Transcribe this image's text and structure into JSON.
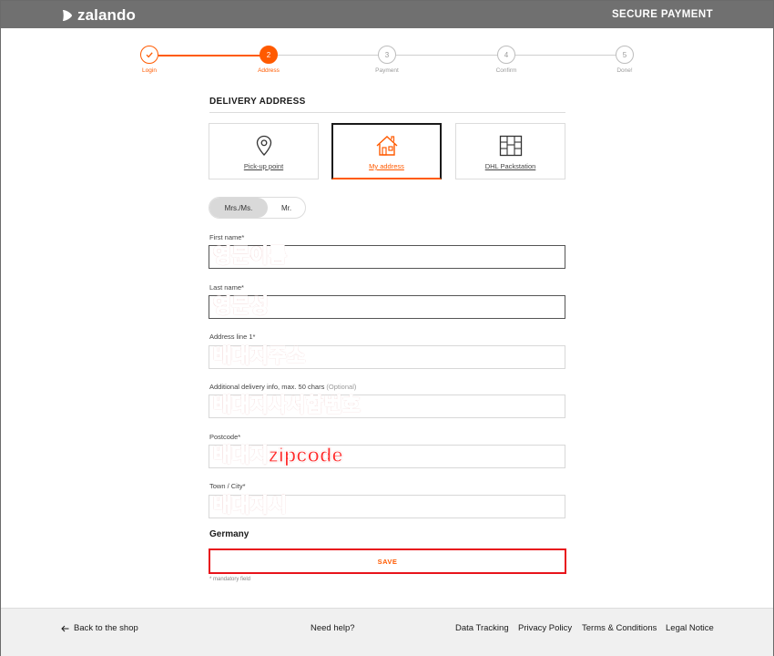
{
  "header": {
    "brand": "zalando",
    "secure_label": "SECURE PAYMENT",
    "bg_color": "#707070",
    "accent_color": "#ff5a00"
  },
  "steps": [
    {
      "number": "1",
      "label": "Login",
      "state": "done"
    },
    {
      "number": "2",
      "label": "Address",
      "state": "active"
    },
    {
      "number": "3",
      "label": "Payment",
      "state": "todo"
    },
    {
      "number": "4",
      "label": "Confirm",
      "state": "todo"
    },
    {
      "number": "5",
      "label": "Done!",
      "state": "todo"
    }
  ],
  "delivery": {
    "title": "DELIVERY ADDRESS",
    "options": [
      {
        "label": "Pick-up point",
        "icon": "location-pin-icon",
        "selected": false
      },
      {
        "label": "My address",
        "icon": "house-icon",
        "selected": true
      },
      {
        "label": "DHL Packstation",
        "icon": "locker-icon",
        "selected": false
      }
    ]
  },
  "salutation": {
    "selected": "Mrs./Ms.",
    "options": [
      "Mrs./Ms.",
      "Mr."
    ]
  },
  "form": {
    "first_name": {
      "label": "First name*",
      "value": "영문이름"
    },
    "last_name": {
      "label": "Last name*",
      "value": "영문성"
    },
    "address1": {
      "label": "Address line 1*",
      "value": "배대지주소"
    },
    "additional": {
      "label": "Additional delivery info, max. 50 chars",
      "hint": "(Optional)",
      "value": "배대지사서함번호"
    },
    "postcode": {
      "label": "Postcode*",
      "value": "배대지zipcode"
    },
    "city": {
      "label": "Town / City*",
      "value": "배대지시"
    },
    "country": "Germany",
    "save_label": "SAVE",
    "mandatory_note": "* mandatory field"
  },
  "footer": {
    "back_label": "Back to the shop",
    "help_label": "Need help?",
    "links": [
      "Data Tracking",
      "Privacy Policy",
      "Terms & Conditions",
      "Legal Notice"
    ]
  }
}
